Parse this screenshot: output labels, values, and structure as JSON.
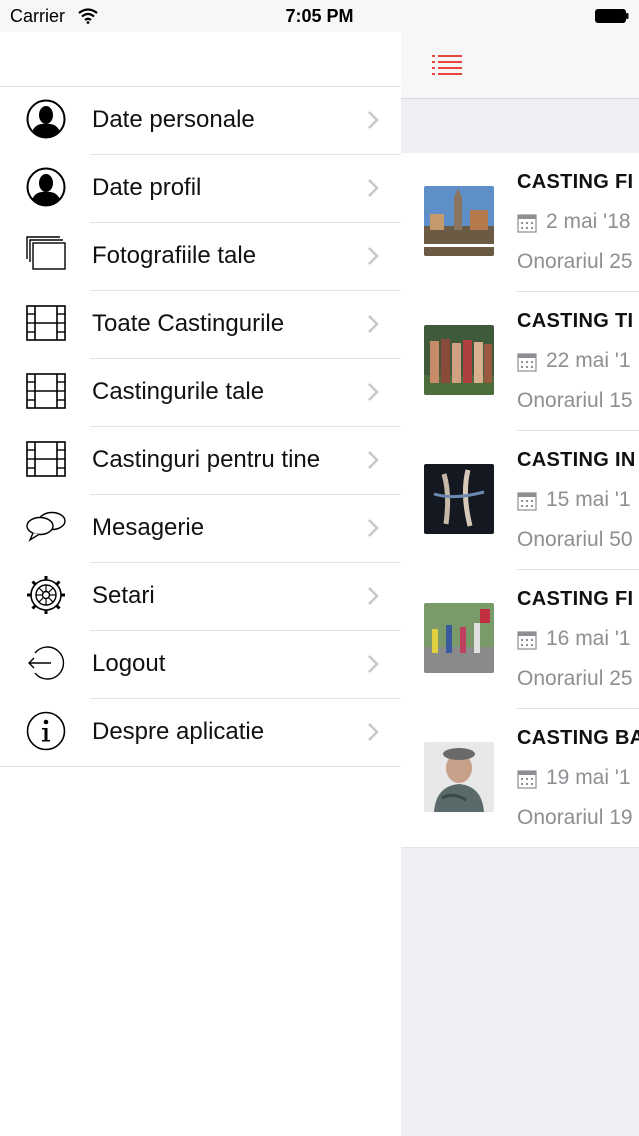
{
  "status_bar": {
    "carrier": "Carrier",
    "time": "7:05 PM"
  },
  "menu": {
    "items": [
      {
        "label": "Date personale",
        "icon": "person-icon"
      },
      {
        "label": "Date profil",
        "icon": "person-icon"
      },
      {
        "label": "Fotografiile tale",
        "icon": "photos-icon"
      },
      {
        "label": "Toate Castingurile",
        "icon": "film-icon"
      },
      {
        "label": "Castingurile tale",
        "icon": "film-icon"
      },
      {
        "label": "Castinguri pentru tine",
        "icon": "film-icon"
      },
      {
        "label": "Mesagerie",
        "icon": "chat-icon"
      },
      {
        "label": "Setari",
        "icon": "gear-icon"
      },
      {
        "label": "Logout",
        "icon": "logout-icon"
      },
      {
        "label": "Despre aplicatie",
        "icon": "info-icon"
      }
    ]
  },
  "main": {
    "accent_color": "#e8463c",
    "castings": [
      {
        "title": "CASTING FI",
        "date": "2 mai '18",
        "fee": "Onorariul 25"
      },
      {
        "title": "CASTING TI",
        "date": "22 mai '1",
        "fee": "Onorariul 15"
      },
      {
        "title": "CASTING IN",
        "date": "15 mai '1",
        "fee": "Onorariul 50"
      },
      {
        "title": "CASTING FI",
        "date": "16 mai '1",
        "fee": "Onorariul 25"
      },
      {
        "title": "CASTING BA",
        "date": "19 mai '1",
        "fee": "Onorariul 19"
      }
    ]
  }
}
